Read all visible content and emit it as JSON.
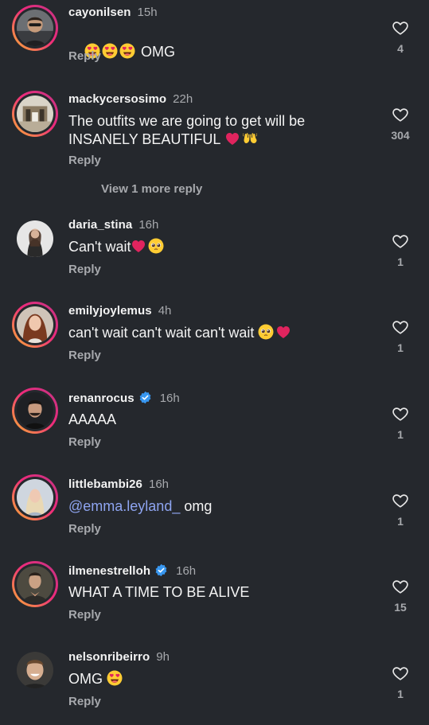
{
  "comments": [
    {
      "username": "cayonilsen",
      "time": "15h",
      "text": " OMG",
      "reply": "Reply",
      "likes": "4"
    },
    {
      "username": "mackycersosimo",
      "time": "22h",
      "text": "The outfits we are going to get will be\nINSANELY BEAUTIFUL",
      "reply": "Reply",
      "likes": "304",
      "more_replies": "View 1 more reply"
    },
    {
      "username": "daria_stina",
      "time": "16h",
      "text": "Can't wait",
      "reply": "Reply",
      "likes": "1"
    },
    {
      "username": "emilyjoylemus",
      "time": "4h",
      "text": "can't wait can't wait can't wait",
      "reply": "Reply",
      "likes": "1"
    },
    {
      "username": "renanrocus",
      "time": "16h",
      "text": "AAAAA",
      "reply": "Reply",
      "likes": "1",
      "verified": true
    },
    {
      "username": "littlebambi26",
      "time": "16h",
      "mention": "@emma.leyland_",
      "text": " omg",
      "reply": "Reply",
      "likes": "1"
    },
    {
      "username": "ilmenestrelloh",
      "time": "16h",
      "text": "WHAT A TIME TO BE ALIVE",
      "reply": "Reply",
      "likes": "15",
      "verified": true
    },
    {
      "username": "nelsonribeirro",
      "time": "9h",
      "text": "OMG",
      "reply": "Reply",
      "likes": "1"
    }
  ],
  "colors": {
    "background": "#25282d",
    "secondary_text": "#a7a9ad",
    "mention": "#8ea4f0",
    "verified": "#3897f0",
    "heart_emoji": "#e0245e"
  }
}
